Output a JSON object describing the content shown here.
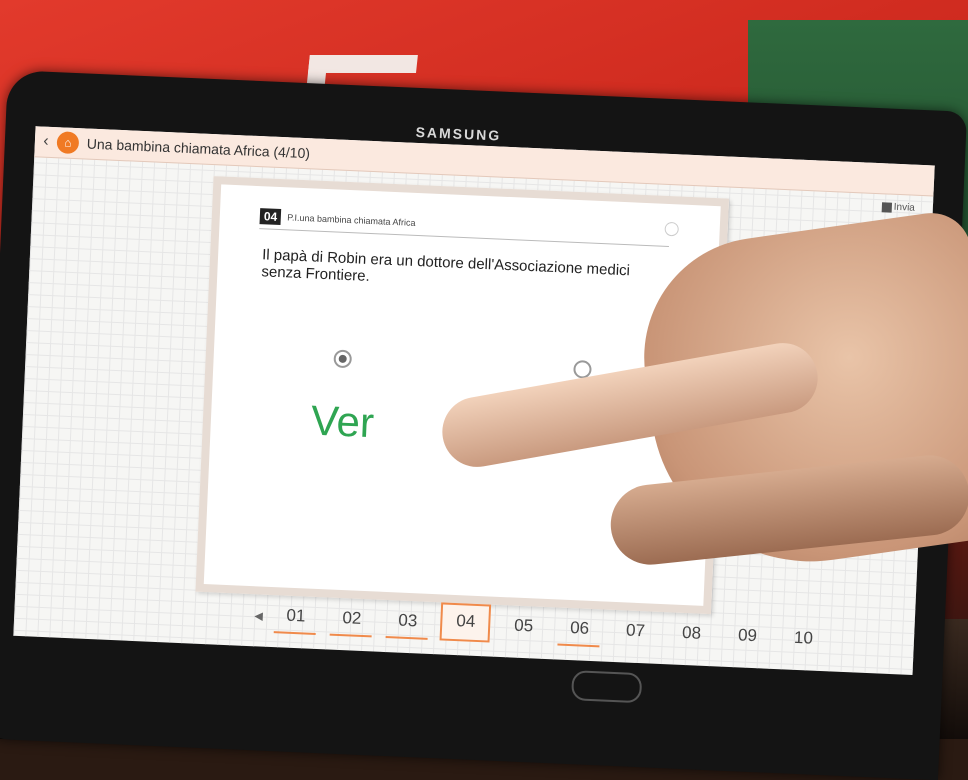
{
  "device": {
    "brand": "SAMSUNG"
  },
  "app": {
    "title": "Una bambina chiamata Africa (4/10)",
    "send_label": "Invia"
  },
  "question": {
    "number": "04",
    "source": "P.I.una bambina chiamata Africa",
    "text": "Il papà  di Robin  era un dottore dell'Associazione medici senza Frontiere.",
    "option_true": "Ver",
    "selected": "true"
  },
  "pager": {
    "pages": [
      "01",
      "02",
      "03",
      "04",
      "05",
      "06",
      "07",
      "08",
      "09",
      "10"
    ],
    "active": "04",
    "answered": [
      "01",
      "02",
      "03",
      "06"
    ]
  },
  "colors": {
    "accent": "#f08a4b",
    "answer_green": "#2fa552",
    "topbar": "#fbe9df"
  }
}
